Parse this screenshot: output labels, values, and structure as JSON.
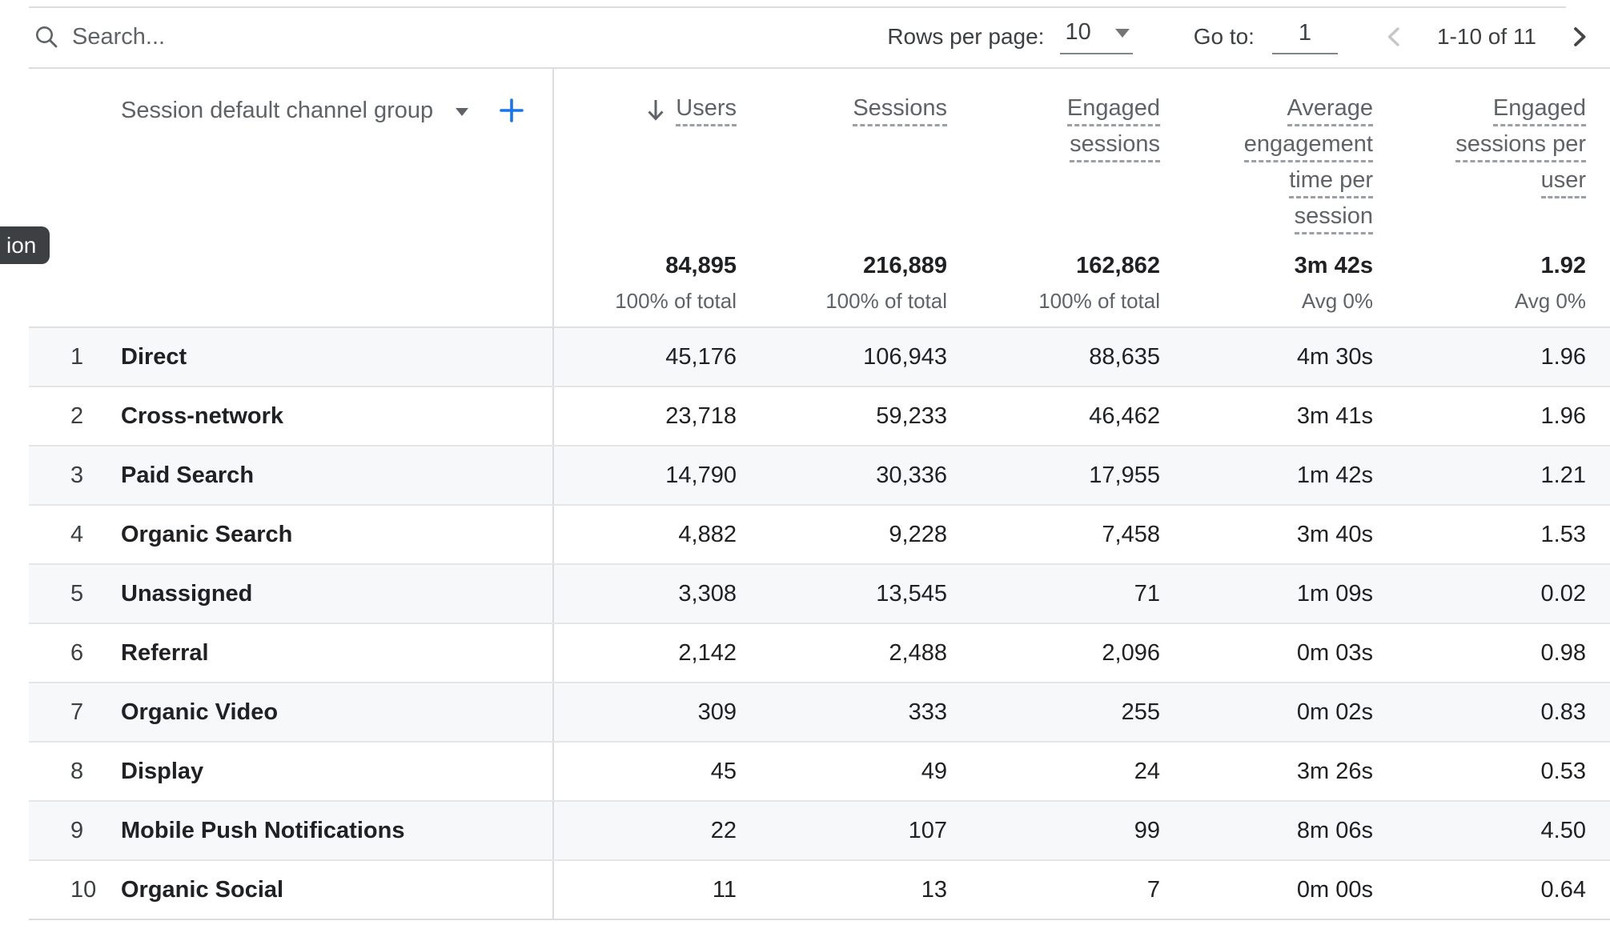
{
  "toolbar": {
    "search_placeholder": "Search...",
    "rows_per_page_label": "Rows per page:",
    "rows_per_page_value": "10",
    "go_to_label": "Go to:",
    "go_to_value": "1",
    "range_text": "1-10 of 11"
  },
  "tooltip_clipped": "ion",
  "table": {
    "dimension_header": "Session default channel group",
    "columns": [
      {
        "id": "users",
        "label_lines": [
          "Users"
        ],
        "sorted": true,
        "total": "84,895",
        "total_sub": "100% of total"
      },
      {
        "id": "sessions",
        "label_lines": [
          "Sessions"
        ],
        "sorted": false,
        "total": "216,889",
        "total_sub": "100% of total"
      },
      {
        "id": "engaged-sessions",
        "label_lines": [
          "Engaged",
          "sessions"
        ],
        "sorted": false,
        "total": "162,862",
        "total_sub": "100% of total"
      },
      {
        "id": "average-engagement-time-per-session",
        "label_lines": [
          "Average",
          "engagement",
          "time per",
          "session"
        ],
        "sorted": false,
        "total": "3m 42s",
        "total_sub": "Avg 0%"
      },
      {
        "id": "engaged-sessions-per-user",
        "label_lines": [
          "Engaged",
          "sessions per",
          "user"
        ],
        "sorted": false,
        "total": "1.92",
        "total_sub": "Avg 0%"
      }
    ],
    "rows": [
      {
        "index": "1",
        "channel": "Direct",
        "values": [
          "45,176",
          "106,943",
          "88,635",
          "4m 30s",
          "1.96"
        ]
      },
      {
        "index": "2",
        "channel": "Cross-network",
        "values": [
          "23,718",
          "59,233",
          "46,462",
          "3m 41s",
          "1.96"
        ]
      },
      {
        "index": "3",
        "channel": "Paid Search",
        "values": [
          "14,790",
          "30,336",
          "17,955",
          "1m 42s",
          "1.21"
        ]
      },
      {
        "index": "4",
        "channel": "Organic Search",
        "values": [
          "4,882",
          "9,228",
          "7,458",
          "3m 40s",
          "1.53"
        ]
      },
      {
        "index": "5",
        "channel": "Unassigned",
        "values": [
          "3,308",
          "13,545",
          "71",
          "1m 09s",
          "0.02"
        ]
      },
      {
        "index": "6",
        "channel": "Referral",
        "values": [
          "2,142",
          "2,488",
          "2,096",
          "0m 03s",
          "0.98"
        ]
      },
      {
        "index": "7",
        "channel": "Organic Video",
        "values": [
          "309",
          "333",
          "255",
          "0m 02s",
          "0.83"
        ]
      },
      {
        "index": "8",
        "channel": "Display",
        "values": [
          "45",
          "49",
          "24",
          "3m 26s",
          "0.53"
        ]
      },
      {
        "index": "9",
        "channel": "Mobile Push Notifications",
        "values": [
          "22",
          "107",
          "99",
          "8m 06s",
          "4.50"
        ]
      },
      {
        "index": "10",
        "channel": "Organic Social",
        "values": [
          "11",
          "13",
          "7",
          "0m 00s",
          "0.64"
        ]
      }
    ]
  },
  "colors": {
    "accent_blue": "#1a73e8",
    "header_text": "#5f6368",
    "body_text": "#202124",
    "row_stripe": "#f7f8f9",
    "border": "#dadce0",
    "tooltip_bg": "#3c4043",
    "disabled_chevron": "#c4c7c5"
  }
}
